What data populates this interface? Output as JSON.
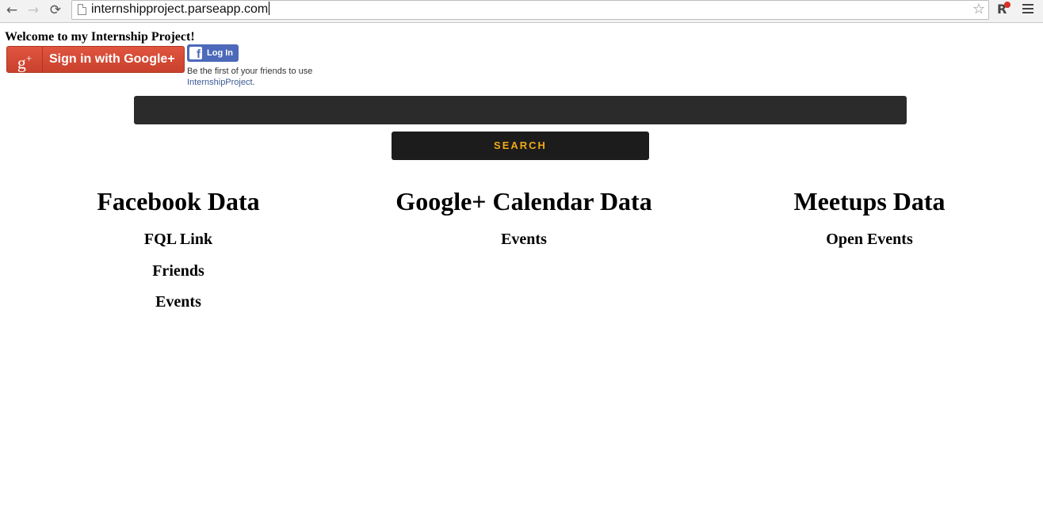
{
  "browser": {
    "url": "internshipproject.parseapp.com",
    "back_glyph": "←",
    "forward_glyph": "→",
    "reload_glyph": "⟳",
    "star_glyph": "☆",
    "extension_glyph": "R"
  },
  "page": {
    "welcome": "Welcome to my Internship Project!",
    "google_signin_label": "Sign in with Google+",
    "google_logo_text": "g",
    "google_logo_plus": "+",
    "facebook_login_label": "Log In",
    "facebook_logo_text": "f",
    "facebook_social_text": "Be the first of your friends to use",
    "facebook_app_link": "InternshipProject",
    "facebook_social_suffix": ".",
    "search_value": "",
    "search_button_label": "SEARCH"
  },
  "sections": {
    "facebook": {
      "title": "Facebook Data",
      "links": [
        "FQL Link",
        "Friends",
        "Events"
      ]
    },
    "google": {
      "title": "Google+ Calendar Data",
      "links": [
        "Events"
      ]
    },
    "meetup": {
      "title": "Meetups Data",
      "links": [
        "Open Events"
      ]
    }
  },
  "colors": {
    "google_red": "#d34836",
    "facebook_blue": "#4c69ba",
    "search_bar_bg": "#2b2b2b",
    "search_button_text": "#f0a818"
  }
}
